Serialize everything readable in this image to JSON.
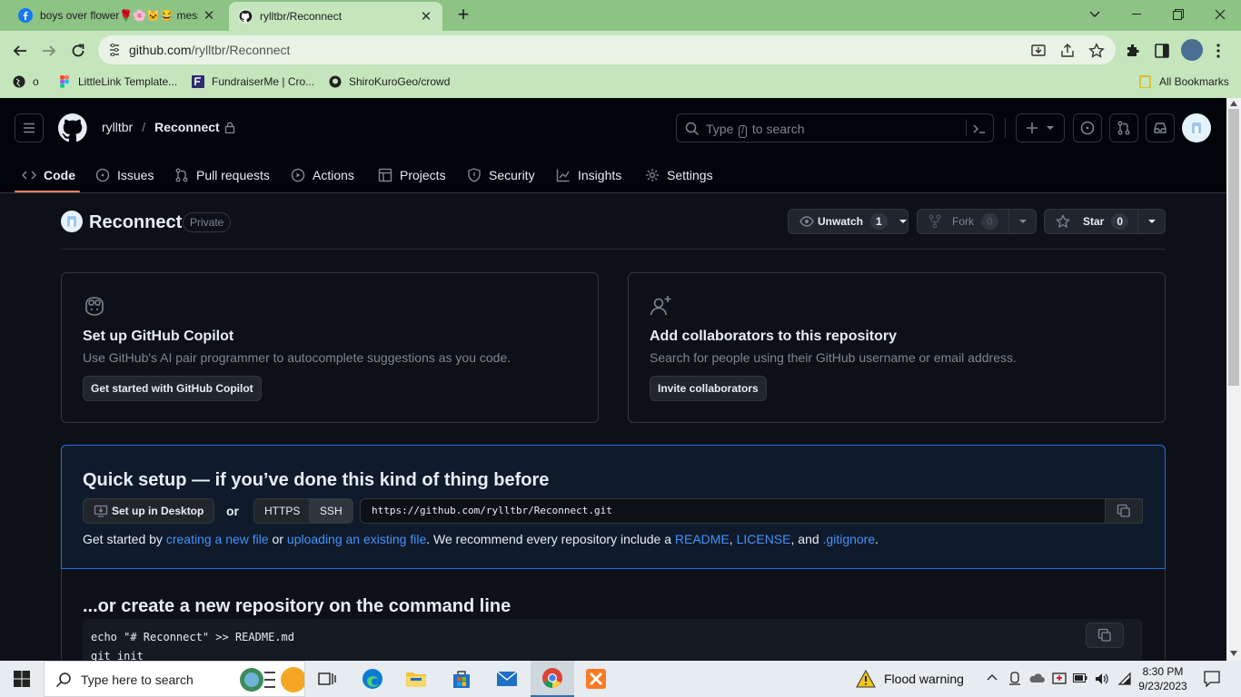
{
  "browser": {
    "tabs": [
      {
        "title": "boys over flower🌹🌸🐱😂 mess",
        "active": false
      },
      {
        "title": "rylltbr/Reconnect",
        "active": true
      }
    ],
    "url_host": "github.com",
    "url_path": "/rylltbr/Reconnect",
    "bookmarks": [
      {
        "label": "o"
      },
      {
        "label": "LittleLink Template..."
      },
      {
        "label": "FundraiserMe | Cro..."
      },
      {
        "label": "ShiroKuroGeo/crowd"
      }
    ],
    "all_bookmarks": "All Bookmarks"
  },
  "github": {
    "owner": "rylltbr",
    "repo": "Reconnect",
    "search_prefix": "Type",
    "search_key": "/",
    "search_suffix": "to search",
    "nav": [
      {
        "label": "Code",
        "icon": "code-icon"
      },
      {
        "label": "Issues",
        "icon": "issue-icon"
      },
      {
        "label": "Pull requests",
        "icon": "pull-request-icon"
      },
      {
        "label": "Actions",
        "icon": "play-icon"
      },
      {
        "label": "Projects",
        "icon": "table-icon"
      },
      {
        "label": "Security",
        "icon": "shield-icon"
      },
      {
        "label": "Insights",
        "icon": "graph-icon"
      },
      {
        "label": "Settings",
        "icon": "gear-icon"
      }
    ],
    "visibility": "Private",
    "unwatch_label": "Unwatch",
    "watch_count": "1",
    "fork_label": "Fork",
    "fork_count": "0",
    "star_label": "Star",
    "star_count": "0"
  },
  "cards": {
    "copilot": {
      "title": "Set up GitHub Copilot",
      "desc": "Use GitHub's AI pair programmer to autocomplete suggestions as you code.",
      "button": "Get started with GitHub Copilot"
    },
    "collab": {
      "title": "Add collaborators to this repository",
      "desc": "Search for people using their GitHub username or email address.",
      "button": "Invite collaborators"
    }
  },
  "quick_setup": {
    "title": "Quick setup — if you’ve done this kind of thing before",
    "desktop_button": "Set up in Desktop",
    "or": "or",
    "https_label": "HTTPS",
    "ssh_label": "SSH",
    "clone_url": "https://github.com/rylltbr/Reconnect.git",
    "desc_1": "Get started by ",
    "link_new_file": "creating a new file",
    "desc_2": " or ",
    "link_upload": "uploading an existing file",
    "desc_3": ". We recommend every repository include a ",
    "link_readme": "README",
    "desc_4": ", ",
    "link_license": "LICENSE",
    "desc_5": ", and ",
    "link_gitignore": ".gitignore",
    "desc_6": "."
  },
  "command_line": {
    "title": "...or create a new repository on the command line",
    "lines": [
      "echo \"# Reconnect\" >> README.md",
      "git init"
    ]
  },
  "taskbar": {
    "search_placeholder": "Type here to search",
    "weather": "Flood warning",
    "time": "8:30 PM",
    "date": "9/23/2023"
  },
  "colors": {
    "accent": "#f78166",
    "link": "#4493f8",
    "quick_border": "#1f6feb",
    "tab_strip": "#8dc385",
    "toolbar": "#c5e5bd"
  }
}
